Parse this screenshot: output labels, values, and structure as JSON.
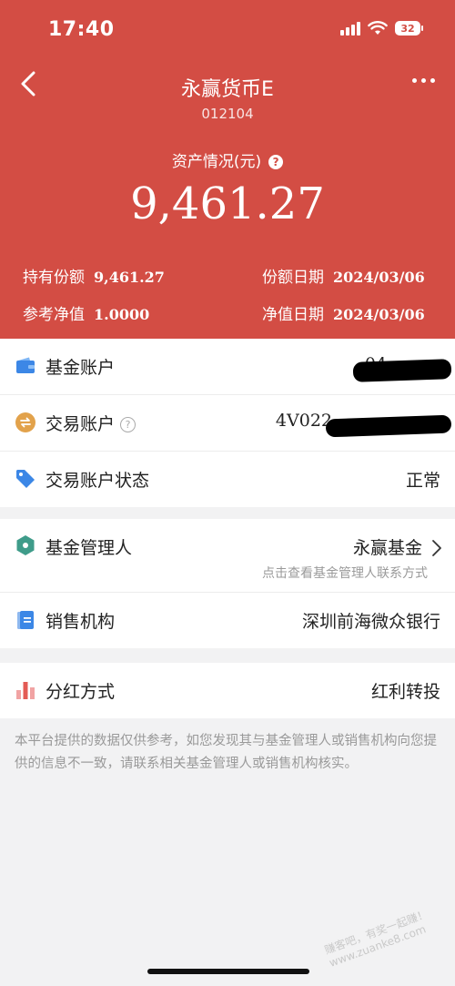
{
  "status_bar": {
    "time": "17:40",
    "battery": "32"
  },
  "header": {
    "title": "永赢货币E",
    "code": "012104",
    "asset_label": "资产情况(元)",
    "asset_help": "?",
    "asset_value": "9,461.27",
    "holding_label": "持有份额",
    "holding_value": "9,461.27",
    "share_date_label": "份额日期",
    "share_date_value": "2024/03/06",
    "nav_label": "参考净值",
    "nav_value": "1.0000",
    "nav_date_label": "净值日期",
    "nav_date_value": "2024/03/06"
  },
  "accounts": {
    "fund_account_label": "基金账户",
    "fund_account_value": "04",
    "trade_account_label": "交易账户",
    "trade_account_help": "?",
    "trade_account_value": "4V022",
    "status_label": "交易账户状态",
    "status_value": "正常"
  },
  "management": {
    "manager_label": "基金管理人",
    "manager_value": "永赢基金",
    "manager_hint": "点击查看基金管理人联系方式",
    "seller_label": "销售机构",
    "seller_value": "深圳前海微众银行"
  },
  "dividend": {
    "label": "分红方式",
    "value": "红利转投"
  },
  "disclaimer": "本平台提供的数据仅供参考，如您发现其与基金管理人或销售机构向您提供的信息不一致，请联系相关基金管理人或销售机构核实。",
  "watermark": "赚客吧，有奖一起赚！ www.zuanke8.com",
  "colors": {
    "header_bg": "#d34d44",
    "page_bg": "#f2f2f3"
  }
}
